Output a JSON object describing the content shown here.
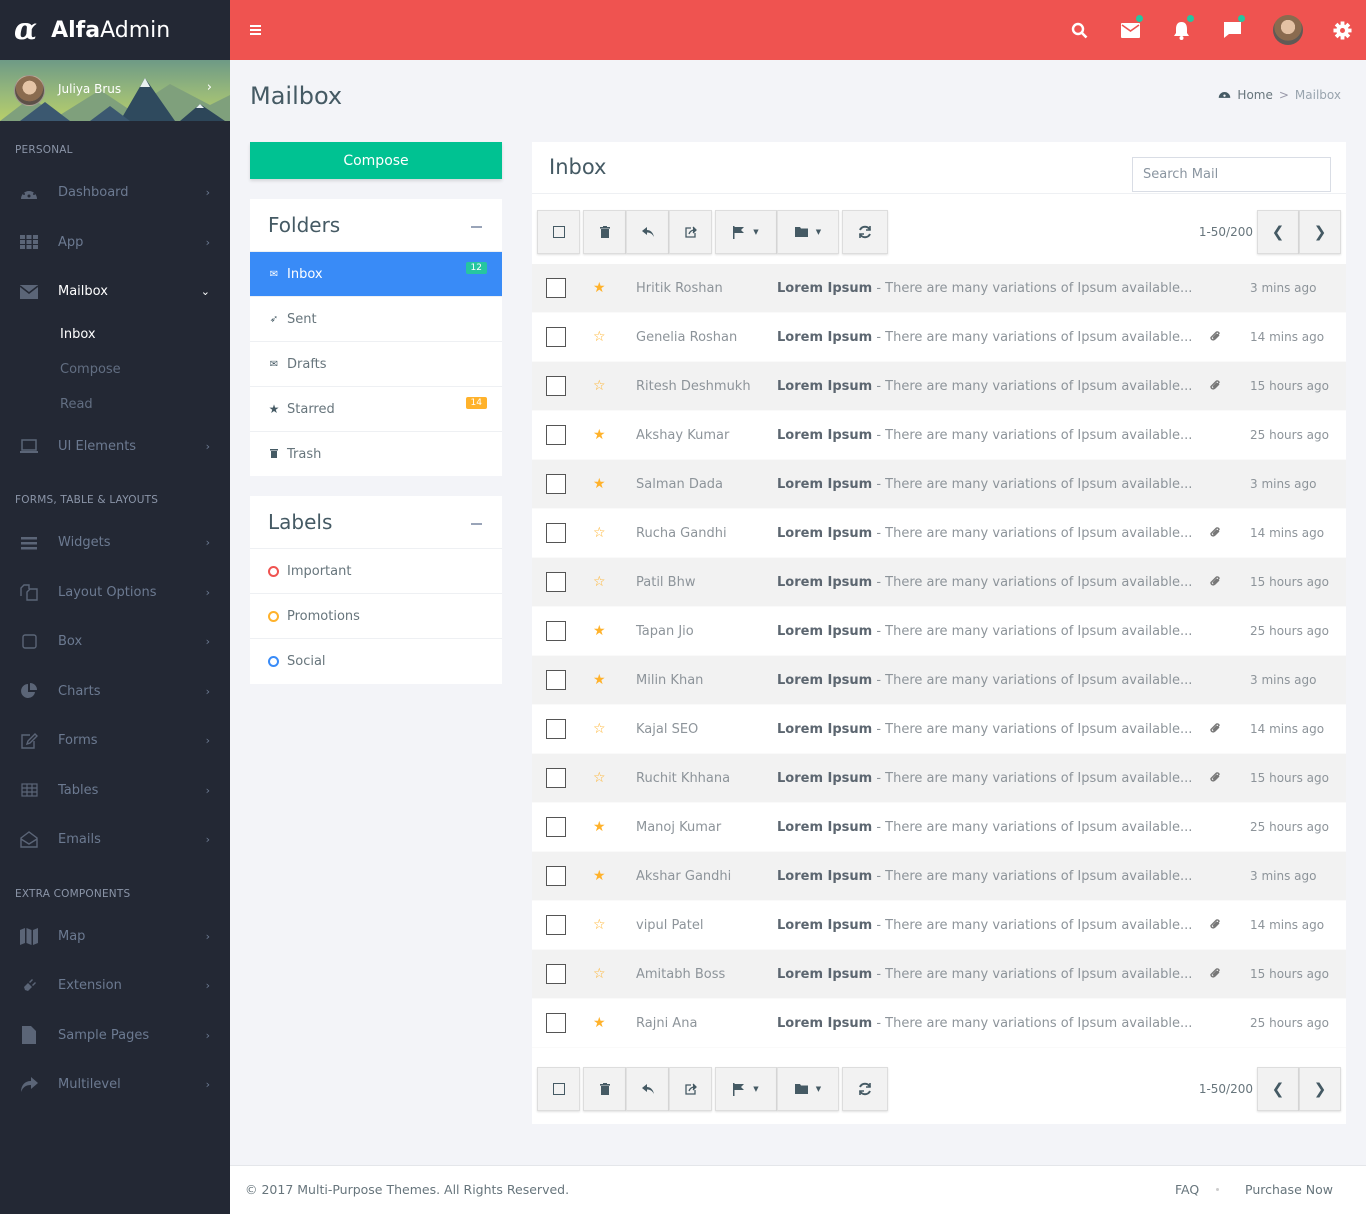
{
  "brand": {
    "logo_glyph": "α",
    "name_bold": "Alfa",
    "name_light": "Admin"
  },
  "user": {
    "name": "Juliya Brus"
  },
  "sidebar": {
    "sections": [
      {
        "title": "PERSONAL"
      },
      {
        "title": "FORMS, TABLE & LAYOUTS"
      },
      {
        "title": "EXTRA COMPONENTS"
      }
    ],
    "personal": [
      {
        "label": "Dashboard",
        "icon": "dashboard-icon"
      },
      {
        "label": "App",
        "icon": "grid-icon"
      },
      {
        "label": "Mailbox",
        "icon": "envelope-icon",
        "active": true
      },
      {
        "label": "UI Elements",
        "icon": "laptop-icon"
      }
    ],
    "mailbox_sub": [
      {
        "label": "Inbox",
        "active": true
      },
      {
        "label": "Compose"
      },
      {
        "label": "Read"
      }
    ],
    "forms": [
      {
        "label": "Widgets",
        "icon": "bars-icon"
      },
      {
        "label": "Layout Options",
        "icon": "copy-icon"
      },
      {
        "label": "Box",
        "icon": "square-icon"
      },
      {
        "label": "Charts",
        "icon": "pie-chart-icon"
      },
      {
        "label": "Forms",
        "icon": "edit-icon"
      },
      {
        "label": "Tables",
        "icon": "table-icon"
      },
      {
        "label": "Emails",
        "icon": "envelope-open-icon"
      }
    ],
    "extra": [
      {
        "label": "Map",
        "icon": "map-icon"
      },
      {
        "label": "Extension",
        "icon": "plug-icon"
      },
      {
        "label": "Sample Pages",
        "icon": "file-icon"
      },
      {
        "label": "Multilevel",
        "icon": "share-icon"
      }
    ]
  },
  "topbar": {
    "icons": [
      "menu-icon",
      "search-icon",
      "mail-icon",
      "bell-icon",
      "chat-icon",
      "profile-avatar",
      "gear-icon"
    ],
    "accent": "#ef5350",
    "indicator_color": "#26c6a0"
  },
  "page": {
    "title": "Mailbox"
  },
  "breadcrumb": {
    "home": "Home",
    "separator": ">",
    "current": "Mailbox"
  },
  "compose": {
    "label": "Compose",
    "color": "#00c292"
  },
  "folders": {
    "title": "Folders",
    "items": [
      {
        "label": "Inbox",
        "icon": "envelope-icon",
        "badge": "12",
        "badge_color": "#26c6a0",
        "active": true
      },
      {
        "label": "Sent",
        "icon": "paper-plane-icon"
      },
      {
        "label": "Drafts",
        "icon": "draft-icon"
      },
      {
        "label": "Starred",
        "icon": "star-icon",
        "badge": "14",
        "badge_color": "#ffb22b"
      },
      {
        "label": "Trash",
        "icon": "trash-icon"
      }
    ]
  },
  "labels": {
    "title": "Labels",
    "items": [
      {
        "label": "Important",
        "color": "#ef5350"
      },
      {
        "label": "Promotions",
        "color": "#ffb22b"
      },
      {
        "label": "Social",
        "color": "#398bf7"
      }
    ]
  },
  "inbox": {
    "title": "Inbox",
    "search_placeholder": "Search Mail",
    "pagination": "1-50/200",
    "emails": [
      {
        "from": "Hritik Roshan",
        "subject": "Lorem Ipsum",
        "preview": " - There are many variations of Ipsum available...",
        "starred": true,
        "attachment": false,
        "time": "3 mins ago"
      },
      {
        "from": "Genelia Roshan",
        "subject": "Lorem Ipsum",
        "preview": " - There are many variations of Ipsum available...",
        "starred": false,
        "attachment": true,
        "time": "14 mins ago"
      },
      {
        "from": "Ritesh Deshmukh",
        "subject": "Lorem Ipsum",
        "preview": " - There are many variations of Ipsum available...",
        "starred": false,
        "attachment": true,
        "time": "15 hours ago"
      },
      {
        "from": "Akshay Kumar",
        "subject": "Lorem Ipsum",
        "preview": " - There are many variations of Ipsum available...",
        "starred": true,
        "attachment": false,
        "time": "25 hours ago"
      },
      {
        "from": "Salman Dada",
        "subject": "Lorem Ipsum",
        "preview": " - There are many variations of Ipsum available...",
        "starred": true,
        "attachment": false,
        "time": "3 mins ago"
      },
      {
        "from": "Rucha Gandhi",
        "subject": "Lorem Ipsum",
        "preview": " - There are many variations of Ipsum available...",
        "starred": false,
        "attachment": true,
        "time": "14 mins ago"
      },
      {
        "from": "Patil Bhw",
        "subject": "Lorem Ipsum",
        "preview": " - There are many variations of Ipsum available...",
        "starred": false,
        "attachment": true,
        "time": "15 hours ago"
      },
      {
        "from": "Tapan Jio",
        "subject": "Lorem Ipsum",
        "preview": " - There are many variations of Ipsum available...",
        "starred": true,
        "attachment": false,
        "time": "25 hours ago"
      },
      {
        "from": "Milin Khan",
        "subject": "Lorem Ipsum",
        "preview": " - There are many variations of Ipsum available...",
        "starred": true,
        "attachment": false,
        "time": "3 mins ago"
      },
      {
        "from": "Kajal SEO",
        "subject": "Lorem Ipsum",
        "preview": " - There are many variations of Ipsum available...",
        "starred": false,
        "attachment": true,
        "time": "14 mins ago"
      },
      {
        "from": "Ruchit Khhana",
        "subject": "Lorem Ipsum",
        "preview": " - There are many variations of Ipsum available...",
        "starred": false,
        "attachment": true,
        "time": "15 hours ago"
      },
      {
        "from": "Manoj Kumar",
        "subject": "Lorem Ipsum",
        "preview": " - There are many variations of Ipsum available...",
        "starred": true,
        "attachment": false,
        "time": "25 hours ago"
      },
      {
        "from": "Akshar Gandhi",
        "subject": "Lorem Ipsum",
        "preview": " - There are many variations of Ipsum available...",
        "starred": true,
        "attachment": false,
        "time": "3 mins ago"
      },
      {
        "from": "vipul Patel",
        "subject": "Lorem Ipsum",
        "preview": " - There are many variations of Ipsum available...",
        "starred": false,
        "attachment": true,
        "time": "14 mins ago"
      },
      {
        "from": "Amitabh Boss",
        "subject": "Lorem Ipsum",
        "preview": " - There are many variations of Ipsum available...",
        "starred": false,
        "attachment": true,
        "time": "15 hours ago"
      },
      {
        "from": "Rajni Ana",
        "subject": "Lorem Ipsum",
        "preview": " - There are many variations of Ipsum available...",
        "starred": true,
        "attachment": false,
        "time": "25 hours ago"
      }
    ]
  },
  "footer": {
    "copyright": "© 2017 Multi-Purpose Themes. All Rights Reserved.",
    "links": [
      "FAQ",
      "Purchase Now"
    ]
  }
}
